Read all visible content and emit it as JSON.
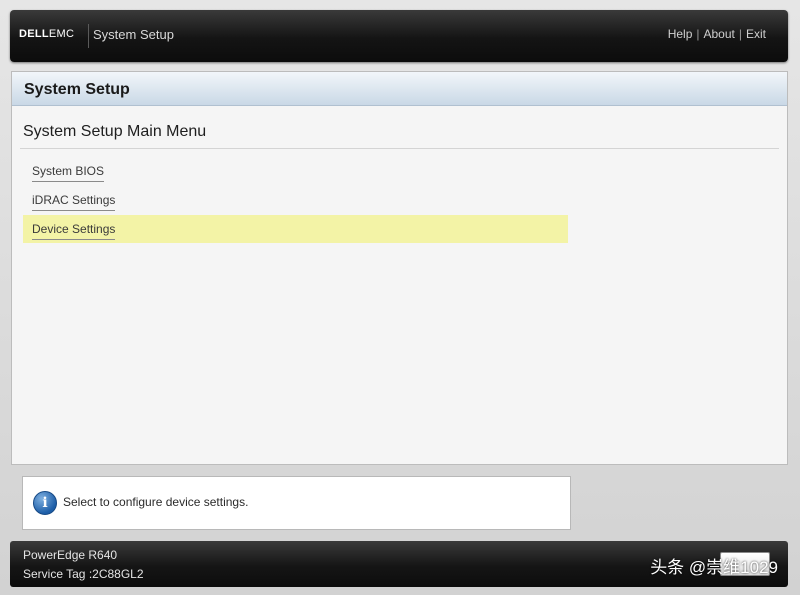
{
  "topbar": {
    "logo_brand": "DELL",
    "logo_suffix": "EMC",
    "title": "System Setup",
    "links": {
      "help": "Help",
      "about": "About",
      "exit": "Exit",
      "separator": "|"
    }
  },
  "panel": {
    "header_title": "System Setup",
    "menu_title": "System Setup Main Menu",
    "items": [
      {
        "label": "System BIOS",
        "selected": false
      },
      {
        "label": "iDRAC Settings",
        "selected": false
      },
      {
        "label": "Device Settings",
        "selected": true
      }
    ]
  },
  "info": {
    "icon": "info-icon",
    "text": "Select to configure device settings."
  },
  "footer": {
    "model": "PowerEdge R640",
    "service_tag_label": "Service Tag :",
    "service_tag_value": "2C88GL2",
    "watermark": "头条 @崇维1029"
  },
  "colors": {
    "selected_row": "#f3f3a6",
    "header_gradient_top": "#f2f6fa",
    "header_gradient_bottom": "#c9d8e6",
    "bar_dark": "#141414",
    "info_icon_blue": "#1d5ea8"
  }
}
